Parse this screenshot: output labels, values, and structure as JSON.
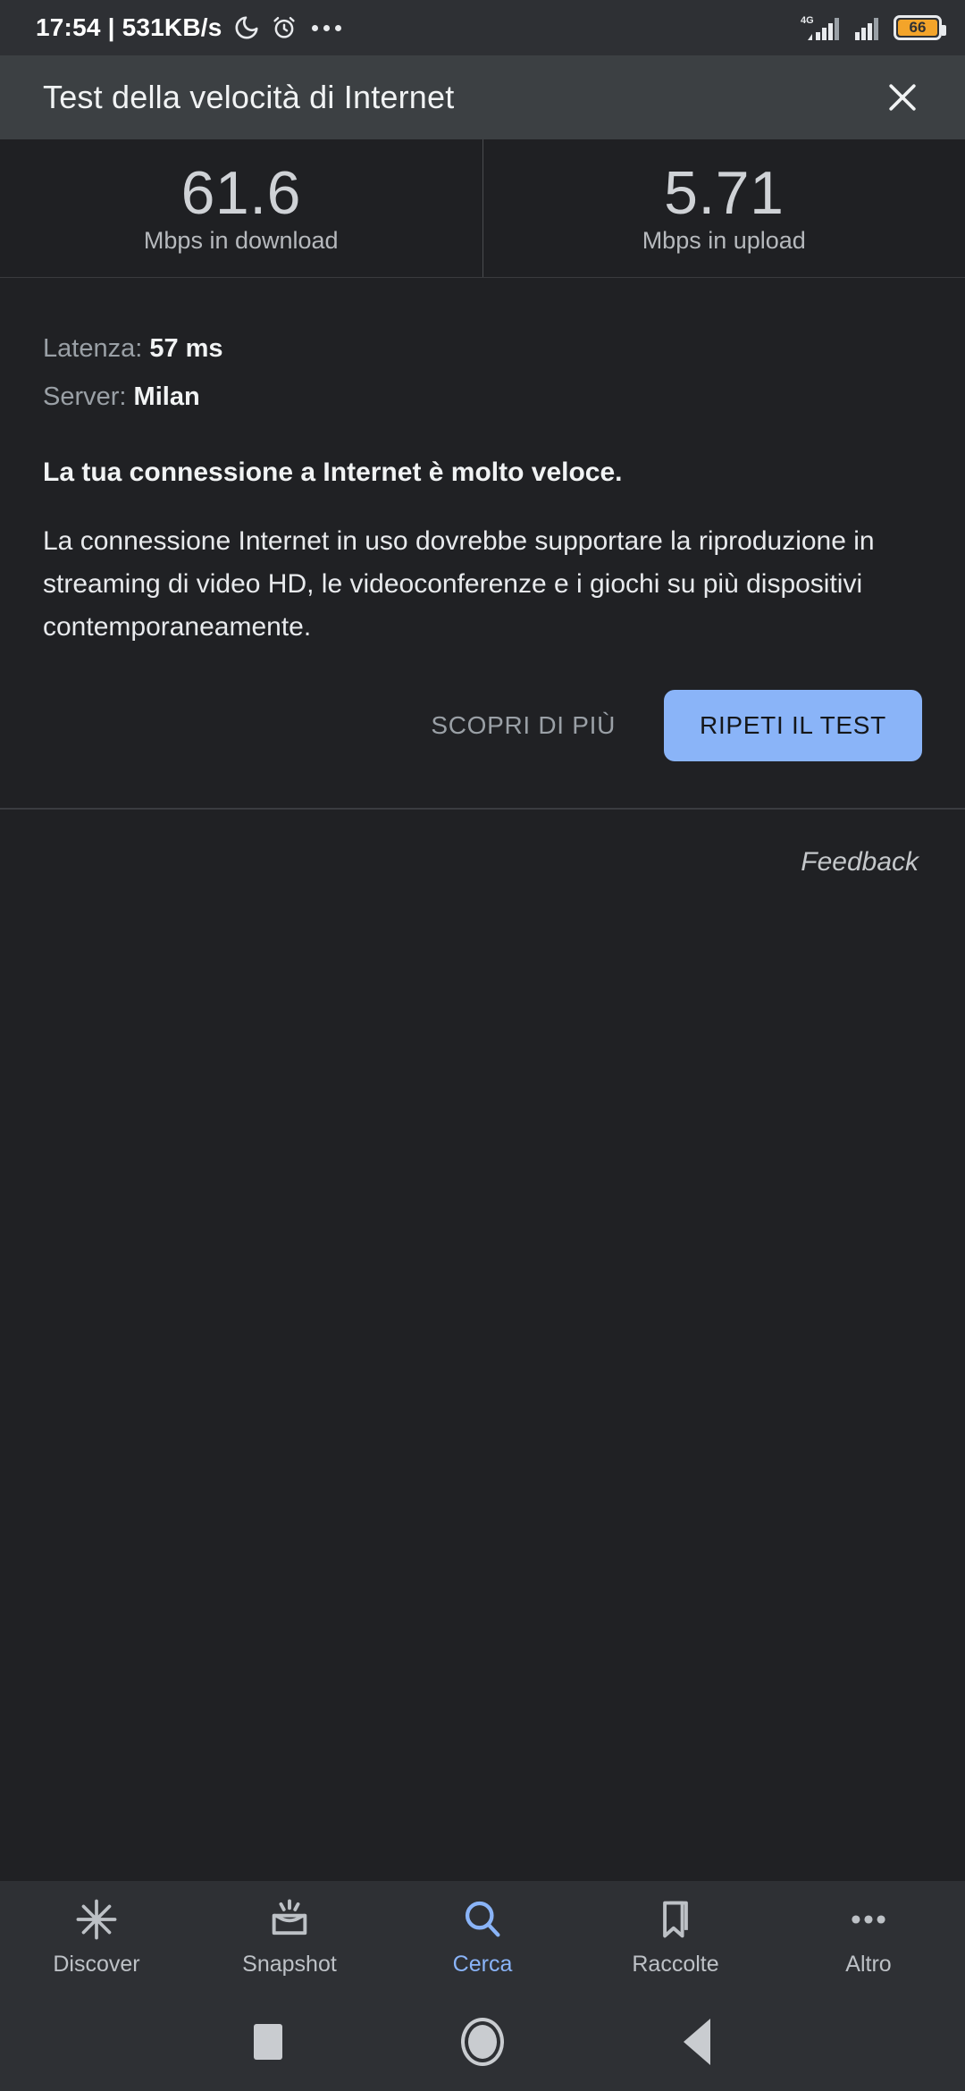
{
  "statusbar": {
    "clock_and_net": "17:54 | 531KB/s",
    "icons": [
      "moon-icon",
      "alarm-icon",
      "more-dots-icon"
    ],
    "network_type": "4G",
    "battery_percent": "66"
  },
  "header": {
    "title": "Test della velocità di Internet",
    "close_label": "close-icon"
  },
  "results": {
    "download": {
      "value": "61.6",
      "label": "Mbps in download"
    },
    "upload": {
      "value": "5.71",
      "label": "Mbps in upload"
    }
  },
  "details": {
    "latency_label": "Latenza:",
    "latency_value": "57 ms",
    "server_label": "Server:",
    "server_value": "Milan",
    "headline": "La tua connessione a Internet è molto veloce.",
    "paragraph": "La connessione Internet in uso dovrebbe supportare la riproduzione in streaming di video HD, le videoconferenze e i giochi su più dispositivi contemporaneamente."
  },
  "actions": {
    "learn_more": "SCOPRI DI PIÙ",
    "retry": "RIPETI IL TEST",
    "accent_color": "#8ab4f8"
  },
  "feedback": {
    "label": "Feedback"
  },
  "bottomnav": {
    "items": [
      {
        "label": "Discover",
        "icon": "sparkle-icon",
        "active": false
      },
      {
        "label": "Snapshot",
        "icon": "snapshot-card-icon",
        "active": false
      },
      {
        "label": "Cerca",
        "icon": "search-icon",
        "active": true
      },
      {
        "label": "Raccolte",
        "icon": "bookmark-icon",
        "active": false
      },
      {
        "label": "Altro",
        "icon": "more-dots-icon",
        "active": false
      }
    ],
    "active_color": "#8ab4f8",
    "inactive_color": "#bdc1c6"
  },
  "sysnav": {
    "recents": "recents-square-icon",
    "home": "home-circle-icon",
    "back": "back-triangle-icon"
  }
}
